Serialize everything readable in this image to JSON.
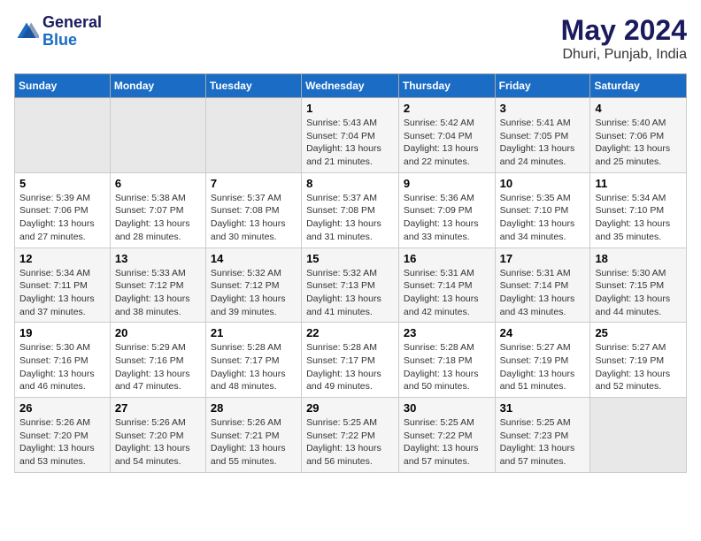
{
  "header": {
    "logo_line1": "General",
    "logo_line2": "Blue",
    "month_year": "May 2024",
    "location": "Dhuri, Punjab, India"
  },
  "weekdays": [
    "Sunday",
    "Monday",
    "Tuesday",
    "Wednesday",
    "Thursday",
    "Friday",
    "Saturday"
  ],
  "weeks": [
    [
      {
        "day": "",
        "empty": true
      },
      {
        "day": "",
        "empty": true
      },
      {
        "day": "",
        "empty": true
      },
      {
        "day": "1",
        "sunrise": "5:43 AM",
        "sunset": "7:04 PM",
        "daylight": "13 hours and 21 minutes."
      },
      {
        "day": "2",
        "sunrise": "5:42 AM",
        "sunset": "7:04 PM",
        "daylight": "13 hours and 22 minutes."
      },
      {
        "day": "3",
        "sunrise": "5:41 AM",
        "sunset": "7:05 PM",
        "daylight": "13 hours and 24 minutes."
      },
      {
        "day": "4",
        "sunrise": "5:40 AM",
        "sunset": "7:06 PM",
        "daylight": "13 hours and 25 minutes."
      }
    ],
    [
      {
        "day": "5",
        "sunrise": "5:39 AM",
        "sunset": "7:06 PM",
        "daylight": "13 hours and 27 minutes."
      },
      {
        "day": "6",
        "sunrise": "5:38 AM",
        "sunset": "7:07 PM",
        "daylight": "13 hours and 28 minutes."
      },
      {
        "day": "7",
        "sunrise": "5:37 AM",
        "sunset": "7:08 PM",
        "daylight": "13 hours and 30 minutes."
      },
      {
        "day": "8",
        "sunrise": "5:37 AM",
        "sunset": "7:08 PM",
        "daylight": "13 hours and 31 minutes."
      },
      {
        "day": "9",
        "sunrise": "5:36 AM",
        "sunset": "7:09 PM",
        "daylight": "13 hours and 33 minutes."
      },
      {
        "day": "10",
        "sunrise": "5:35 AM",
        "sunset": "7:10 PM",
        "daylight": "13 hours and 34 minutes."
      },
      {
        "day": "11",
        "sunrise": "5:34 AM",
        "sunset": "7:10 PM",
        "daylight": "13 hours and 35 minutes."
      }
    ],
    [
      {
        "day": "12",
        "sunrise": "5:34 AM",
        "sunset": "7:11 PM",
        "daylight": "13 hours and 37 minutes."
      },
      {
        "day": "13",
        "sunrise": "5:33 AM",
        "sunset": "7:12 PM",
        "daylight": "13 hours and 38 minutes."
      },
      {
        "day": "14",
        "sunrise": "5:32 AM",
        "sunset": "7:12 PM",
        "daylight": "13 hours and 39 minutes."
      },
      {
        "day": "15",
        "sunrise": "5:32 AM",
        "sunset": "7:13 PM",
        "daylight": "13 hours and 41 minutes."
      },
      {
        "day": "16",
        "sunrise": "5:31 AM",
        "sunset": "7:14 PM",
        "daylight": "13 hours and 42 minutes."
      },
      {
        "day": "17",
        "sunrise": "5:31 AM",
        "sunset": "7:14 PM",
        "daylight": "13 hours and 43 minutes."
      },
      {
        "day": "18",
        "sunrise": "5:30 AM",
        "sunset": "7:15 PM",
        "daylight": "13 hours and 44 minutes."
      }
    ],
    [
      {
        "day": "19",
        "sunrise": "5:30 AM",
        "sunset": "7:16 PM",
        "daylight": "13 hours and 46 minutes."
      },
      {
        "day": "20",
        "sunrise": "5:29 AM",
        "sunset": "7:16 PM",
        "daylight": "13 hours and 47 minutes."
      },
      {
        "day": "21",
        "sunrise": "5:28 AM",
        "sunset": "7:17 PM",
        "daylight": "13 hours and 48 minutes."
      },
      {
        "day": "22",
        "sunrise": "5:28 AM",
        "sunset": "7:17 PM",
        "daylight": "13 hours and 49 minutes."
      },
      {
        "day": "23",
        "sunrise": "5:28 AM",
        "sunset": "7:18 PM",
        "daylight": "13 hours and 50 minutes."
      },
      {
        "day": "24",
        "sunrise": "5:27 AM",
        "sunset": "7:19 PM",
        "daylight": "13 hours and 51 minutes."
      },
      {
        "day": "25",
        "sunrise": "5:27 AM",
        "sunset": "7:19 PM",
        "daylight": "13 hours and 52 minutes."
      }
    ],
    [
      {
        "day": "26",
        "sunrise": "5:26 AM",
        "sunset": "7:20 PM",
        "daylight": "13 hours and 53 minutes."
      },
      {
        "day": "27",
        "sunrise": "5:26 AM",
        "sunset": "7:20 PM",
        "daylight": "13 hours and 54 minutes."
      },
      {
        "day": "28",
        "sunrise": "5:26 AM",
        "sunset": "7:21 PM",
        "daylight": "13 hours and 55 minutes."
      },
      {
        "day": "29",
        "sunrise": "5:25 AM",
        "sunset": "7:22 PM",
        "daylight": "13 hours and 56 minutes."
      },
      {
        "day": "30",
        "sunrise": "5:25 AM",
        "sunset": "7:22 PM",
        "daylight": "13 hours and 57 minutes."
      },
      {
        "day": "31",
        "sunrise": "5:25 AM",
        "sunset": "7:23 PM",
        "daylight": "13 hours and 57 minutes."
      },
      {
        "day": "",
        "empty": true
      }
    ]
  ]
}
